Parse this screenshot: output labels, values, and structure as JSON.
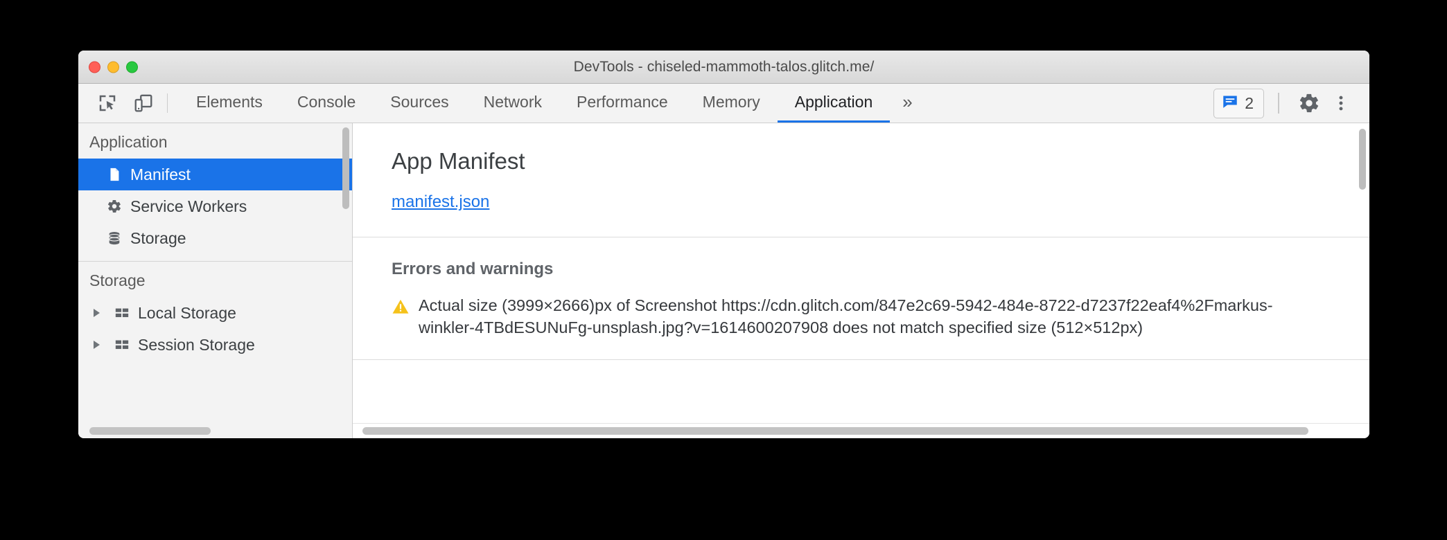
{
  "window": {
    "title": "DevTools - chiseled-mammoth-talos.glitch.me/",
    "controls": [
      {
        "name": "close",
        "color": "#ff5f57"
      },
      {
        "name": "minimize",
        "color": "#febc2e"
      },
      {
        "name": "zoom",
        "color": "#28c840"
      }
    ]
  },
  "toolbar": {
    "inspect_icon": "inspect-element-icon",
    "device_icon": "device-toolbar-icon",
    "tabs": [
      {
        "label": "Elements",
        "active": false
      },
      {
        "label": "Console",
        "active": false
      },
      {
        "label": "Sources",
        "active": false
      },
      {
        "label": "Network",
        "active": false
      },
      {
        "label": "Performance",
        "active": false
      },
      {
        "label": "Memory",
        "active": false
      },
      {
        "label": "Application",
        "active": true
      }
    ],
    "more_tabs_label": "»",
    "message_count": "2",
    "message_icon": "message-bubble-icon",
    "settings_icon": "gear-icon",
    "menu_icon": "kebab-menu-icon",
    "accent": "#1a73e8"
  },
  "sidebar": {
    "sections": [
      {
        "title": "Application",
        "items": [
          {
            "label": "Manifest",
            "icon": "document-icon",
            "selected": true,
            "expandable": false
          },
          {
            "label": "Service Workers",
            "icon": "gear-icon",
            "selected": false,
            "expandable": false
          },
          {
            "label": "Storage",
            "icon": "database-icon",
            "selected": false,
            "expandable": false
          }
        ]
      },
      {
        "title": "Storage",
        "items": [
          {
            "label": "Local Storage",
            "icon": "table-icon",
            "selected": false,
            "expandable": true
          },
          {
            "label": "Session Storage",
            "icon": "table-icon",
            "selected": false,
            "expandable": true
          }
        ]
      }
    ]
  },
  "main": {
    "manifest_title": "App Manifest",
    "manifest_link": "manifest.json",
    "errors_title": "Errors and warnings",
    "warning_icon": "warning-triangle-icon",
    "warning_text": "Actual size (3999×2666)px of Screenshot https://cdn.glitch.com/847e2c69-5942-484e-8722-d7237f22eaf4%2Fmarkus-winkler-4TBdESUNuFg-unsplash.jpg?v=1614600207908 does not match specified size (512×512px)"
  }
}
